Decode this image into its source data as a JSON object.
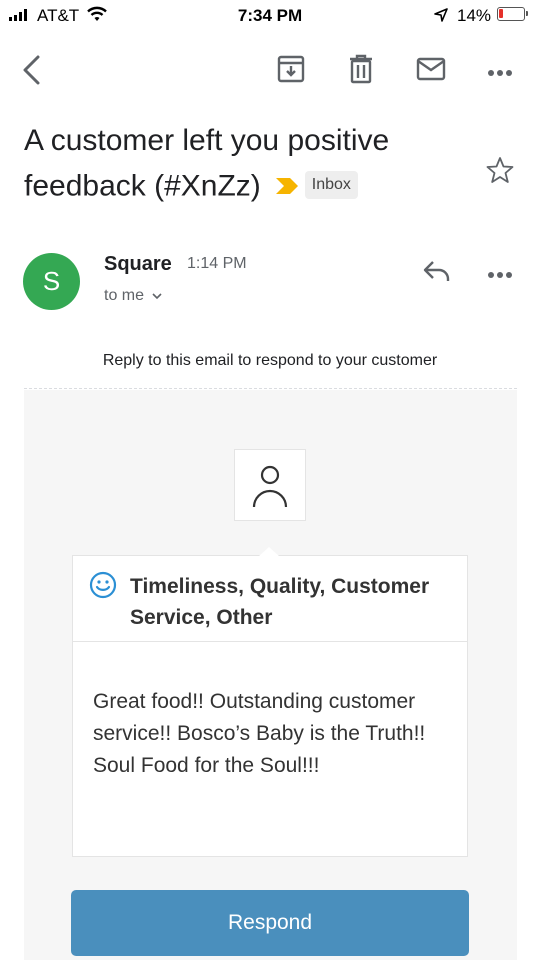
{
  "status_bar": {
    "carrier": "AT&T",
    "time": "7:34 PM",
    "battery": "14%",
    "battery_color": "#e5302a",
    "icons": [
      "signal-icon",
      "wifi-icon",
      "location-arrow-icon",
      "battery-icon"
    ]
  },
  "toolbar": {
    "icons": [
      "back-arrow-icon",
      "archive-icon",
      "trash-icon",
      "mark-unread-icon",
      "more-icon"
    ]
  },
  "email": {
    "subject": "A customer left you positive feedback (#XnZz)",
    "label": "Inbox",
    "important_marker_color": "#f6b400",
    "sender": {
      "initial": "S",
      "name": "Square",
      "time": "1:14 PM",
      "recipient": "to me",
      "avatar_color": "#34a853"
    }
  },
  "body": {
    "reply_note": "Reply to this email to respond to your customer",
    "tags": "Timeliness, Quality, Customer Service, Other",
    "feedback": "Great food!! Outstanding customer service!! Bosco’s Baby is the Truth!! Soul Food for the Soul!!!",
    "respond_label": "Respond",
    "accent_color": "#4a8fbd"
  }
}
